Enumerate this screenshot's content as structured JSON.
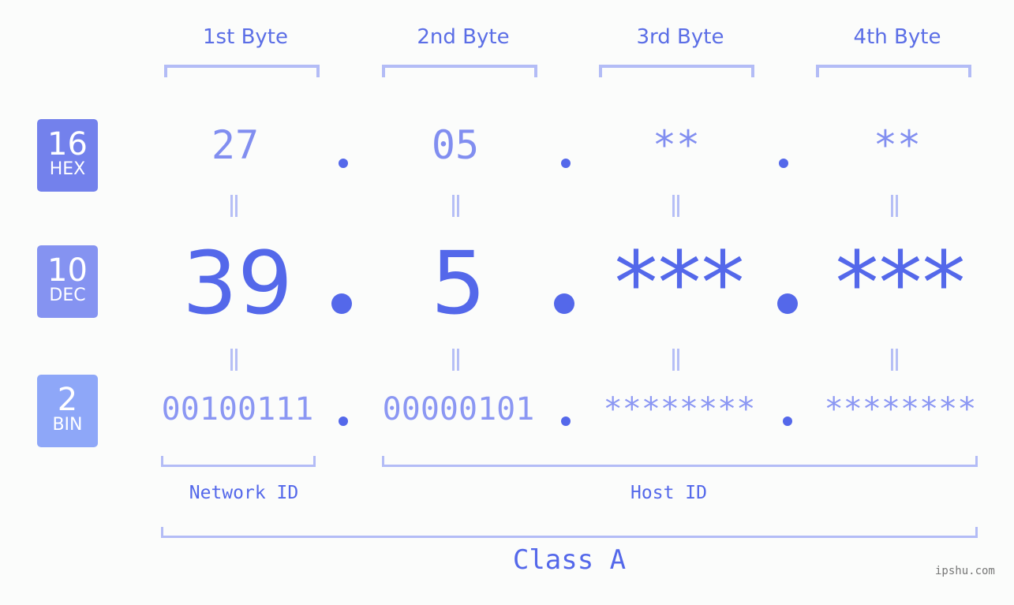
{
  "bytes": [
    {
      "header": "1st Byte",
      "hex": "27",
      "dec": "39",
      "bin": "00100111"
    },
    {
      "header": "2nd Byte",
      "hex": "05",
      "dec": "5",
      "bin": "00000101"
    },
    {
      "header": "3rd Byte",
      "hex": "**",
      "dec": "***",
      "bin": "********"
    },
    {
      "header": "4th Byte",
      "hex": "**",
      "dec": "***",
      "bin": "********"
    }
  ],
  "bases": [
    {
      "num": "16",
      "label": "HEX",
      "color": "#7381ec"
    },
    {
      "num": "10",
      "label": "DEC",
      "color": "#8593f1"
    },
    {
      "num": "2",
      "label": "BIN",
      "color": "#8ea7f8"
    }
  ],
  "network_id_label": "Network ID",
  "host_id_label": "Host ID",
  "class_label": "Class A",
  "watermark": "ipshu.com"
}
